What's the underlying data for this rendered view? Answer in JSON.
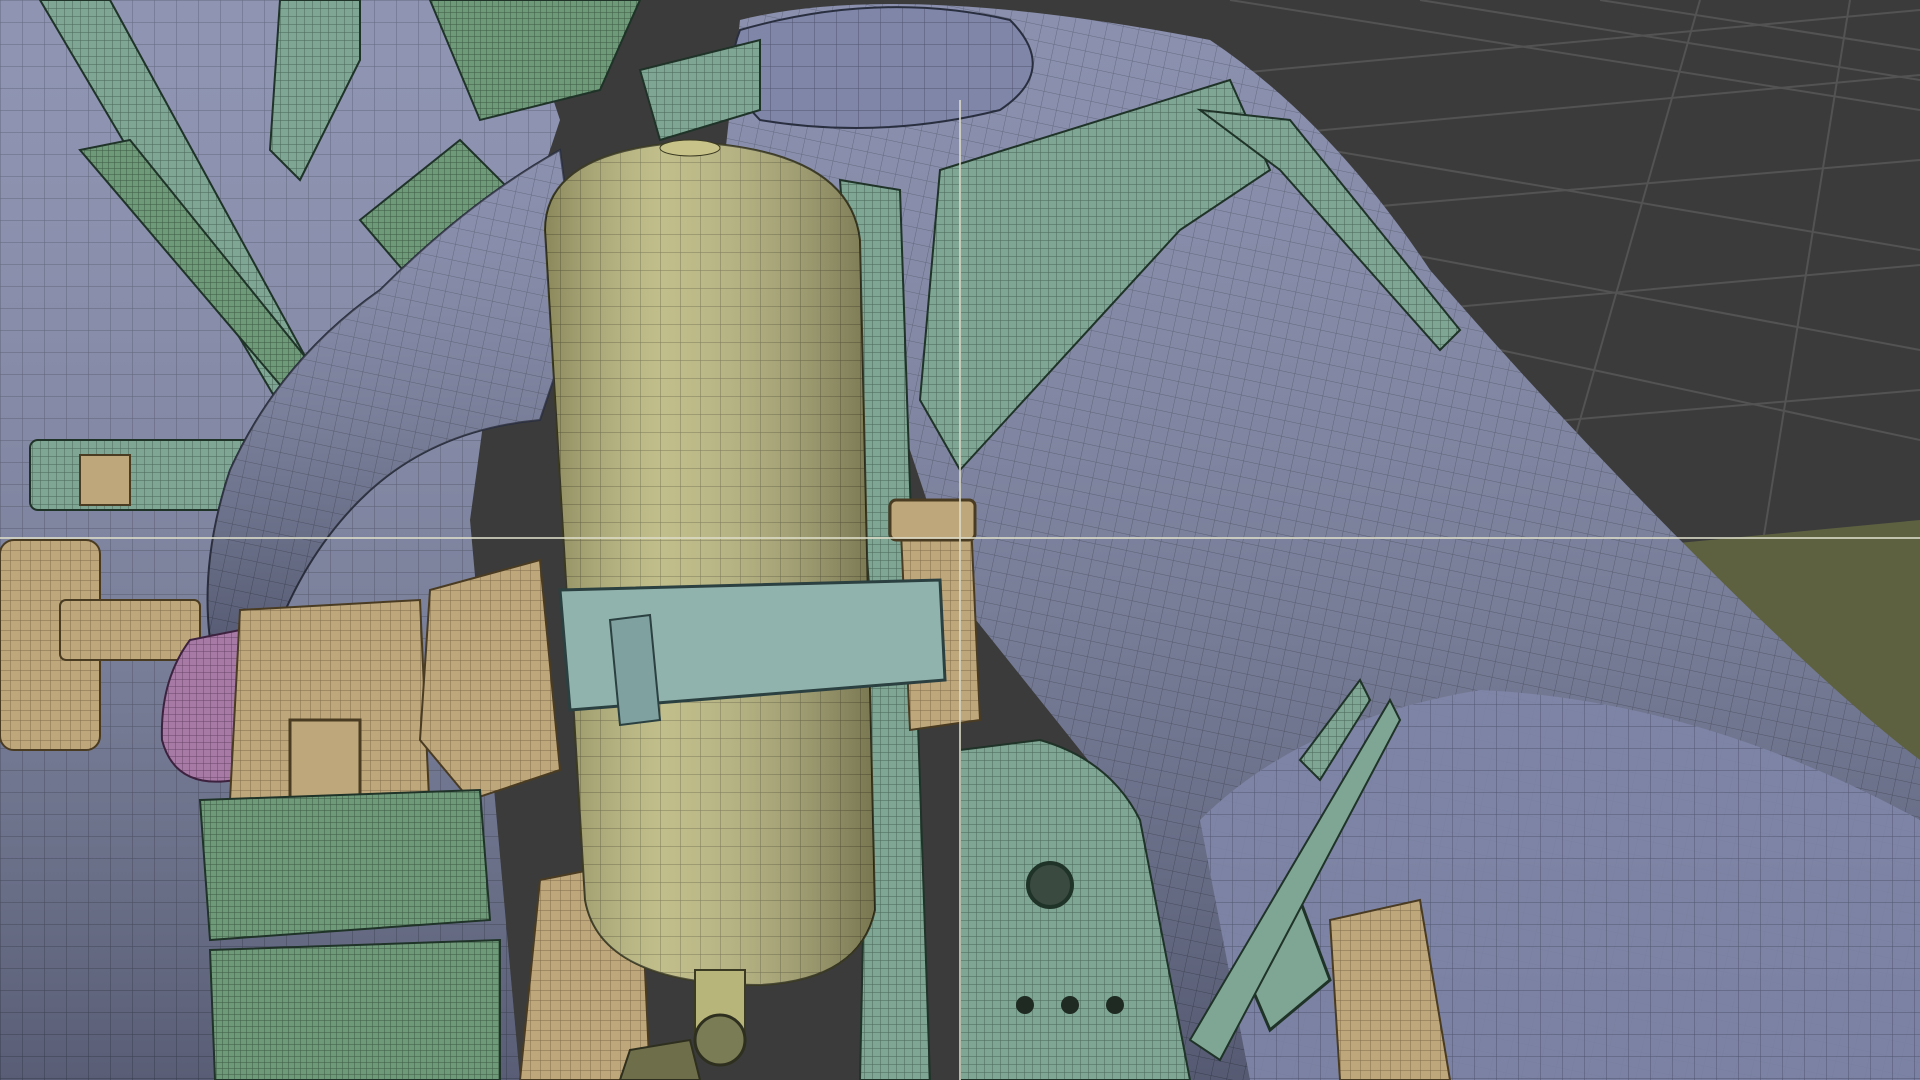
{
  "viewport": {
    "kind": "3d-viewport-wireframe-overlay",
    "colors": {
      "background": "#3b3b3b",
      "grid_lines": "#525252",
      "ground_plane": "#5d6140",
      "skin_suit": "#7f86a8",
      "wire_dark": "#2a2f40",
      "harness": "#7fa695",
      "tank": "#b8b57a",
      "pouches": "#bfa77c",
      "glove": "#a77aa6",
      "crosshair": "#dcdcc8"
    },
    "objects": [
      {
        "name": "character-body-mesh"
      },
      {
        "name": "air-tank-cylinder"
      },
      {
        "name": "backpack-harness-frame"
      },
      {
        "name": "utility-belt-pouches"
      },
      {
        "name": "glove-mesh"
      },
      {
        "name": "second-character-mesh"
      }
    ]
  }
}
